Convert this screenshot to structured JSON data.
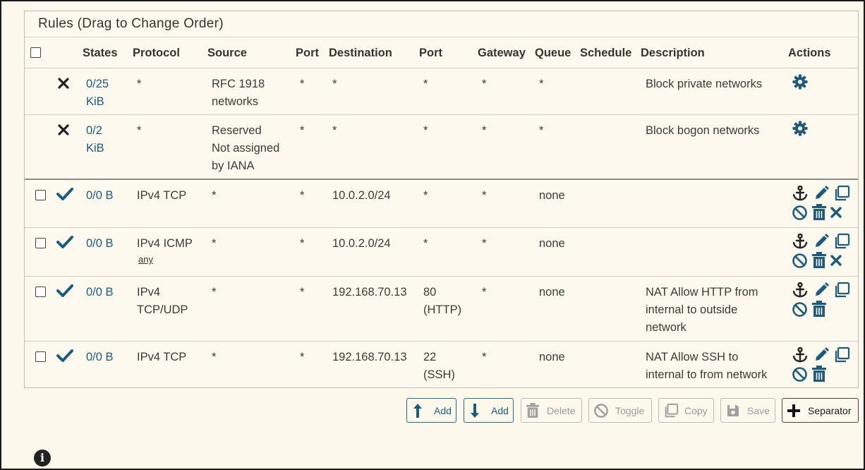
{
  "panel": {
    "title": "Rules (Drag to Change Order)"
  },
  "columns": [
    "States",
    "Protocol",
    "Source",
    "Port",
    "Destination",
    "Port",
    "Gateway",
    "Queue",
    "Schedule",
    "Description",
    "Actions"
  ],
  "rules": [
    {
      "status": "block",
      "states": [
        "0/25",
        "KiB"
      ],
      "protocol": [
        "*"
      ],
      "protocol_sub": "",
      "source": [
        "RFC 1918",
        "networks"
      ],
      "sport": "*",
      "destination": "*",
      "dport": [
        "*"
      ],
      "gateway": "*",
      "queue": "*",
      "schedule": "",
      "description": [
        "Block private networks"
      ],
      "actions": "gear"
    },
    {
      "status": "block",
      "states": [
        "0/2",
        "KiB"
      ],
      "protocol": [
        "*"
      ],
      "protocol_sub": "",
      "source": [
        "Reserved",
        "Not assigned",
        "by IANA"
      ],
      "sport": "*",
      "destination": "*",
      "dport": [
        "*"
      ],
      "gateway": "*",
      "queue": "*",
      "schedule": "",
      "description": [
        "Block bogon networks"
      ],
      "actions": "gear"
    },
    {
      "status": "pass",
      "states": [
        "0/0 B"
      ],
      "protocol": [
        "IPv4 TCP"
      ],
      "protocol_sub": "",
      "source": [
        "*"
      ],
      "sport": "*",
      "destination": "10.0.2.0/24",
      "dport": [
        "*"
      ],
      "gateway": "*",
      "queue": "none",
      "schedule": "",
      "description": [
        ""
      ],
      "actions": "full-x"
    },
    {
      "status": "pass",
      "states": [
        "0/0 B"
      ],
      "protocol": [
        "IPv4 ICMP"
      ],
      "protocol_sub": "any",
      "source": [
        "*"
      ],
      "sport": "*",
      "destination": "10.0.2.0/24",
      "dport": [
        "*"
      ],
      "gateway": "*",
      "queue": "none",
      "schedule": "",
      "description": [
        ""
      ],
      "actions": "full-x"
    },
    {
      "status": "pass",
      "states": [
        "0/0 B"
      ],
      "protocol": [
        "IPv4",
        "TCP/UDP"
      ],
      "protocol_sub": "",
      "source": [
        "*"
      ],
      "sport": "*",
      "destination": "192.168.70.13",
      "dport": [
        "80",
        "(HTTP)"
      ],
      "gateway": "*",
      "queue": "none",
      "schedule": "",
      "description": [
        "NAT Allow HTTP from",
        "internal to outside",
        "network"
      ],
      "actions": "full"
    },
    {
      "status": "pass",
      "states": [
        "0/0 B"
      ],
      "protocol": [
        "IPv4 TCP"
      ],
      "protocol_sub": "",
      "source": [
        "*"
      ],
      "sport": "*",
      "destination": "192.168.70.13",
      "dport": [
        "22",
        "(SSH)"
      ],
      "gateway": "*",
      "queue": "none",
      "schedule": "",
      "description": [
        "NAT Allow SSH to",
        "internal to from network"
      ],
      "actions": "full"
    }
  ],
  "buttons": {
    "add_top": "Add",
    "add_bottom": "Add",
    "delete": "Delete",
    "toggle": "Toggle",
    "copy": "Copy",
    "save": "Save",
    "separator": "Separator"
  },
  "colors": {
    "accent": "#1e5a7a",
    "background": "#fcf8ec"
  }
}
